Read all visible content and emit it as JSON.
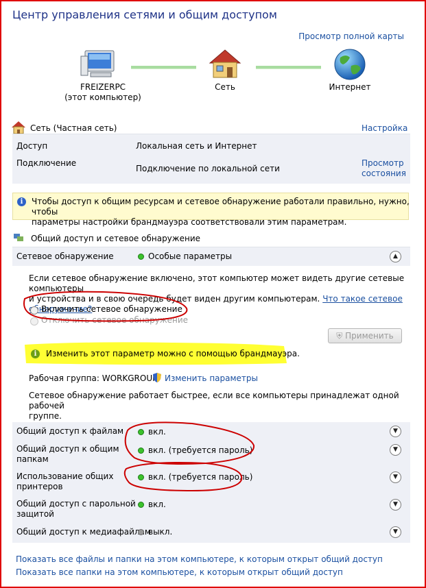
{
  "title": "Центр управления сетями и общим доступом",
  "map_link": "Просмотр полной карты",
  "nodes": {
    "computer_name": "FREIZERPC",
    "computer_sub": "(этот компьютер)",
    "network": "Сеть",
    "internet": "Интернет"
  },
  "network": {
    "name": "Сеть (Частная сеть)",
    "customize": "Настройка",
    "access_label": "Доступ",
    "access_value": "Локальная сеть и Интернет",
    "connection_label": "Подключение",
    "connection_value": "Подключение по локальной сети",
    "view_status_line1": "Просмотр",
    "view_status_line2": "состояния"
  },
  "info_text_line1": "Чтобы доступ к общим ресурсам и сетевое обнаружение работали правильно, нужно, чтобы",
  "info_text_line2": "параметры настройки брандмауэра соответствовали этим параметрам.",
  "sharing": {
    "header": "Общий доступ и сетевое обнаружение",
    "discovery_label": "Сетевое обнаружение",
    "discovery_value": "Особые параметры",
    "desc_line1": "Если сетевое обнаружение включено, этот компьютер может видеть другие сетевые компьютеры",
    "desc_line2": "и устройства и в свою очередь будет виден другим компьютерам.",
    "what_is_line1": "Что такое сетевое",
    "what_is_line2": "обнаружение?",
    "radio_on": "Включить сетевое обнаружение",
    "radio_off": "Отключить сетевое обнаружение",
    "apply": "Применить",
    "firewall_note": "Изменить этот параметр можно с помощью брандмауэра.",
    "workgroup": "Рабочая группа: WORKGROUP",
    "change_settings": "Изменить параметры",
    "faster_line1": "Сетевое обнаружение работает быстрее, если все компьютеры принадлежат одной рабочей",
    "faster_line2": "группе."
  },
  "rows": [
    {
      "label1": "Общий доступ к файлам",
      "label2": "",
      "value": "вкл.",
      "on": true
    },
    {
      "label1": "Общий доступ к общим",
      "label2": "папкам",
      "value": "вкл. (требуется пароль)",
      "on": true
    },
    {
      "label1": "Использование общих",
      "label2": "принтеров",
      "value": "вкл. (требуется пароль)",
      "on": true
    },
    {
      "label1": "Общий доступ с парольной",
      "label2": "защитой",
      "value": "вкл.",
      "on": true
    },
    {
      "label1": "Общий доступ к медиафайлам",
      "label2": "",
      "value": "выкл.",
      "on": false
    }
  ],
  "bottom_links": [
    "Показать все файлы и папки на этом компьютере, к которым открыт общий доступ",
    "Показать все папки на этом компьютере, к которым открыт общий доступ"
  ],
  "colors": {
    "frame": "#e00000",
    "title": "#1e3287",
    "link": "#1a4fa0",
    "highlight": "#ffff33",
    "annotation": "#cc0000",
    "panel": "#eef0f6",
    "info_bg": "#fffbcf"
  }
}
